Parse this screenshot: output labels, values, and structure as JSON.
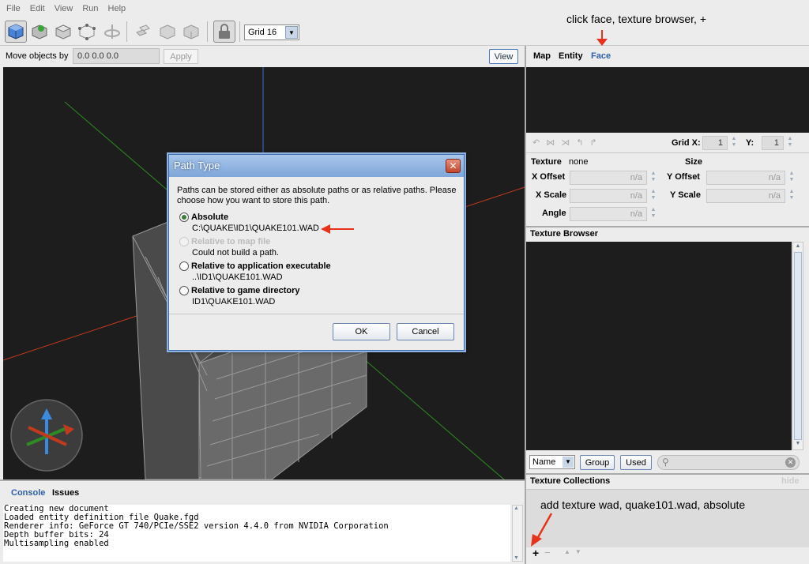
{
  "menu": [
    "File",
    "Edit",
    "View",
    "Run",
    "Help"
  ],
  "toolbar": {
    "grid_label": "Grid 16"
  },
  "move_bar": {
    "label": "Move objects by",
    "value": "0.0 0.0 0.0",
    "apply": "Apply",
    "view": "View"
  },
  "right_tabs": {
    "map": "Map",
    "entity": "Entity",
    "face": "Face"
  },
  "face_panel": {
    "grid_x_label": "Grid X:",
    "grid_x": "1",
    "grid_y_label": "Y:",
    "grid_y": "1",
    "texture_label": "Texture",
    "texture_value": "none",
    "size_label": "Size",
    "x_offset": "X Offset",
    "y_offset": "Y Offset",
    "x_scale": "X Scale",
    "y_scale": "Y Scale",
    "angle": "Angle",
    "na": "n/a"
  },
  "texture_browser": {
    "title": "Texture Browser",
    "sort": "Name",
    "group": "Group",
    "used": "Used"
  },
  "texture_collections": {
    "title": "Texture Collections",
    "hide": "hide",
    "add": "+",
    "remove": "−"
  },
  "console": {
    "tab_console": "Console",
    "tab_issues": "Issues",
    "lines": "Creating new document\nLoaded entity definition file Quake.fgd\nRenderer info: GeForce GT 740/PCIe/SSE2 version 4.4.0 from NVIDIA Corporation\nDepth buffer bits: 24\nMultisampling enabled"
  },
  "dialog": {
    "title": "Path Type",
    "message": "Paths can be stored either as absolute paths or as relative paths. Please choose how you want to store this path.",
    "options": [
      {
        "label": "Absolute",
        "detail": "C:\\QUAKE\\ID1\\QUAKE101.WAD"
      },
      {
        "label": "Relative to map file",
        "detail": "Could not build a path."
      },
      {
        "label": "Relative to application executable",
        "detail": "..\\ID1\\QUAKE101.WAD"
      },
      {
        "label": "Relative to game directory",
        "detail": "ID1\\QUAKE101.WAD"
      }
    ],
    "ok": "OK",
    "cancel": "Cancel"
  },
  "annotations": {
    "top": "click face, texture browser, +",
    "bottom": "add texture wad, quake101.wad, absolute"
  },
  "colors": {
    "accent": "#2f5fa8",
    "annotation_arrow": "#e8331c",
    "viewport_bg": "#1d1d1d"
  }
}
